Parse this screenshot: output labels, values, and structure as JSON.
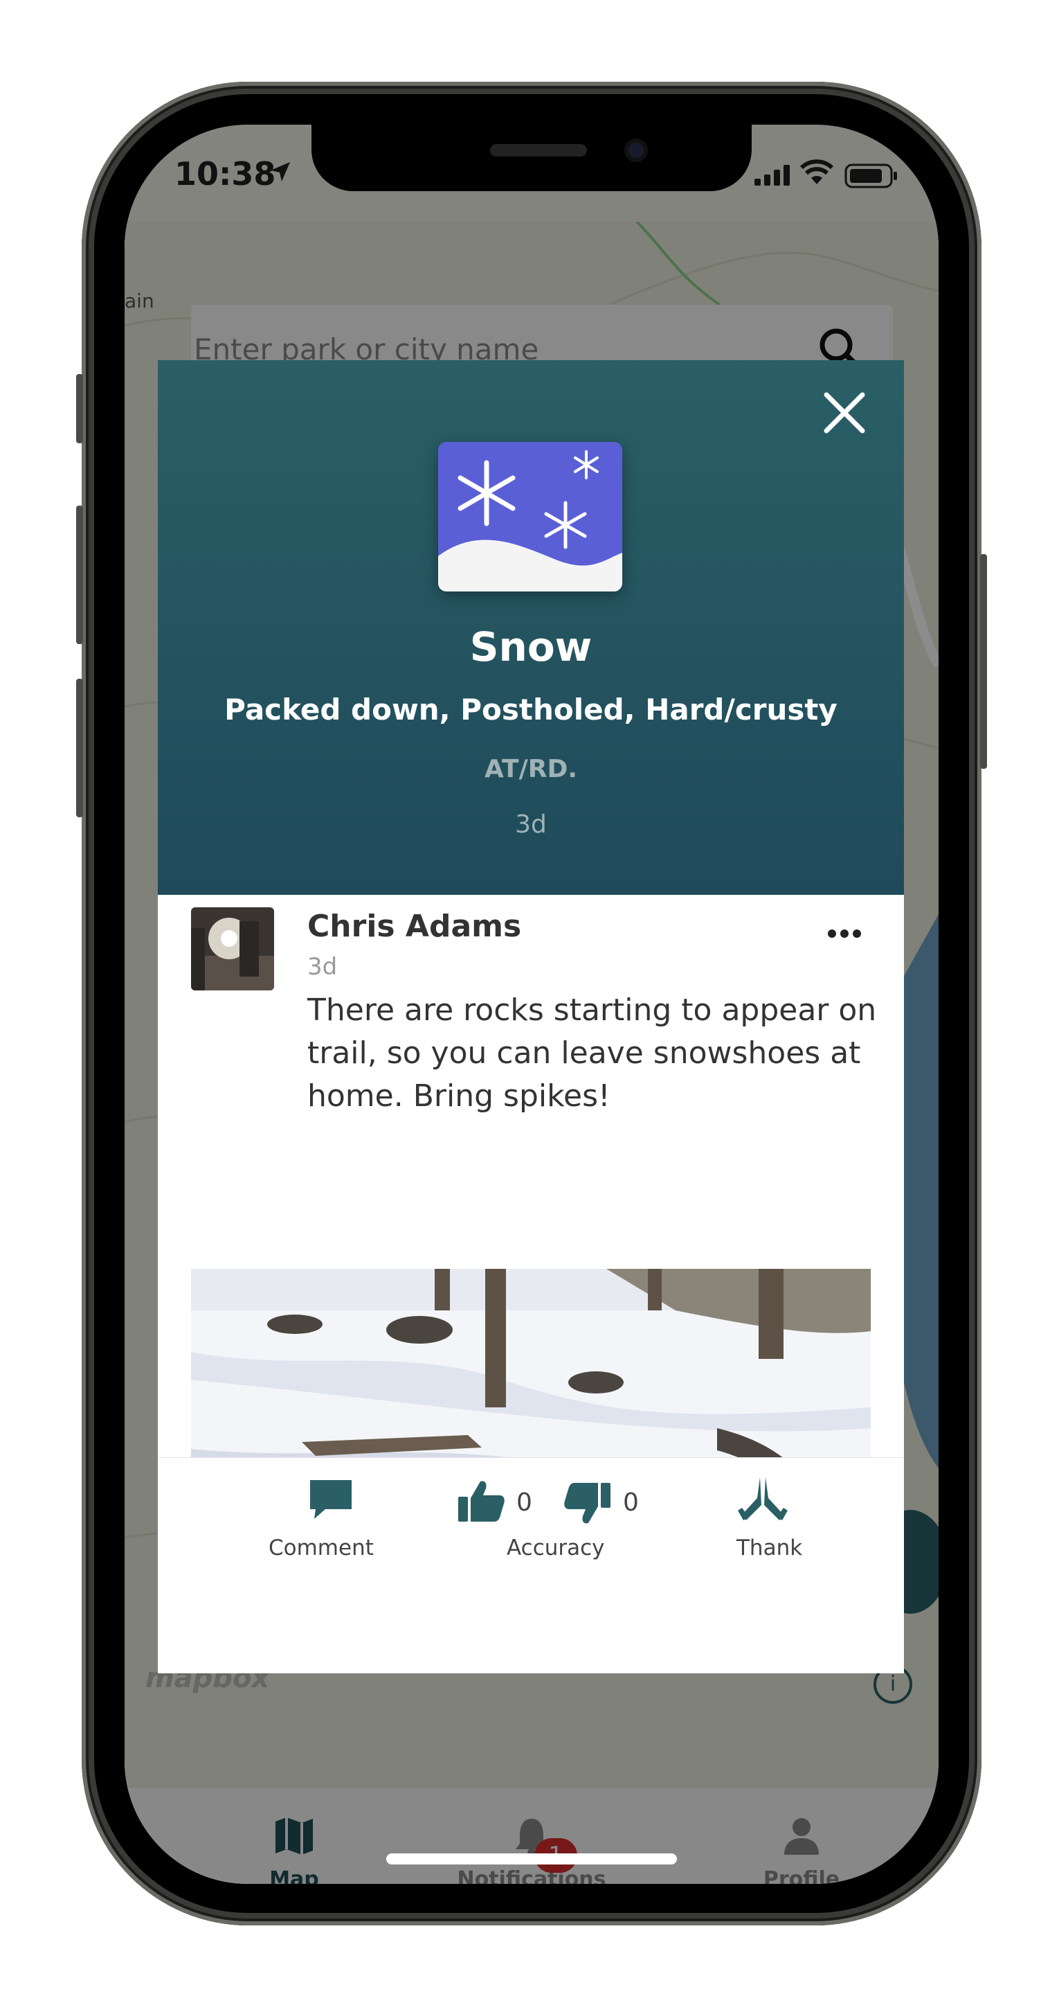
{
  "status_bar": {
    "time": "10:38"
  },
  "map": {
    "corner_label": "ain",
    "search_placeholder": "Enter park or city name",
    "brand": "mapbox"
  },
  "modal": {
    "condition_title": "Snow",
    "condition_subtitle": "Packed down, Postholed, Hard/crusty",
    "trail_name": "AT/RD.",
    "report_age": "3d",
    "icon": "snow-condition-icon"
  },
  "post": {
    "author": "Chris Adams",
    "age": "3d",
    "text": "There are rocks starting to appear on trail, so you can leave snowshoes at home. Bring spikes!"
  },
  "actions": {
    "comment_label": "Comment",
    "accuracy_label": "Accuracy",
    "thank_label": "Thank",
    "thumbs_up_count": "0",
    "thumbs_down_count": "0"
  },
  "tab_bar": {
    "tabs": [
      {
        "label": "Map",
        "icon": "map-icon",
        "active": true
      },
      {
        "label": "Notifications",
        "icon": "bell-icon",
        "badge": "1"
      },
      {
        "label": "Profile",
        "icon": "person-icon"
      }
    ]
  },
  "colors": {
    "header_teal": "#2a5f66",
    "accent_teal": "#1f4f55",
    "snow_purple": "#5b5fd6",
    "badge_red": "#d92f2f"
  }
}
